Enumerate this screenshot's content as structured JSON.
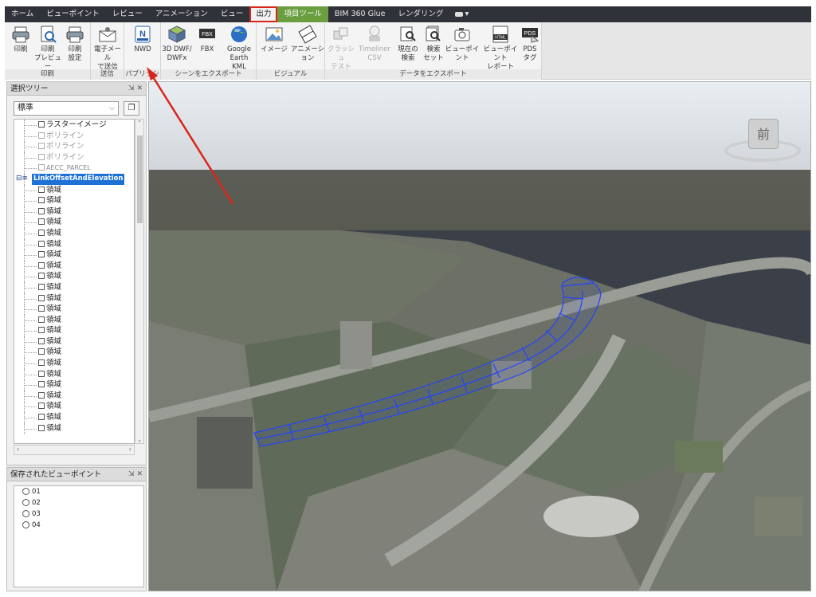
{
  "tabs": [
    {
      "label": "ホーム"
    },
    {
      "label": "ビューポイント"
    },
    {
      "label": "レビュー"
    },
    {
      "label": "アニメーション"
    },
    {
      "label": "ビュー"
    },
    {
      "label": "出力",
      "active": true
    },
    {
      "label": "項目ツール",
      "context": true
    },
    {
      "label": "BIM 360 Glue"
    },
    {
      "label": "レンダリング"
    }
  ],
  "ribbon": {
    "groups": {
      "print": "印刷",
      "send": "送信",
      "publish": "パブリッシュ",
      "export_scene": "シーンをエクスポート",
      "visual": "ビジュアル",
      "export_data": "データをエクスポート"
    },
    "buttons": {
      "print": "印刷",
      "print_preview": "印刷\nプレビュー",
      "print_setup": "印刷\n設定",
      "email": "電子メール\nで送信",
      "nwd": "NWD",
      "dwf": "3D DWF/\nDWFx",
      "fbx": "FBX",
      "kml": "Google\nEarth KML",
      "image": "イメージ",
      "animation": "アニメーション",
      "clash": "クラッシュ\nテスト",
      "timeliner": "Timeliner\nCSV",
      "current_search": "現在の\n検索",
      "search_set": "検索\nセット",
      "viewpoint": "ビューポイント",
      "vp_report": "ビューポイント\nレポート",
      "pds": "PDS\nタグ"
    }
  },
  "selection_tree": {
    "title": "選択ツリー",
    "mode": "標準",
    "items": [
      {
        "label": "ラスターイメージ",
        "dim": false
      },
      {
        "label": "ポリライン",
        "dim": true
      },
      {
        "label": "ポリライン",
        "dim": true
      },
      {
        "label": "ポリライン",
        "dim": true
      },
      {
        "label": "AECC_PARCEL",
        "dim": true,
        "small": true
      },
      {
        "label": "LinkOffsetAndElevation",
        "selected": true
      },
      {
        "label": "領域"
      },
      {
        "label": "領域"
      },
      {
        "label": "領域"
      },
      {
        "label": "領域"
      },
      {
        "label": "領域"
      },
      {
        "label": "領域"
      },
      {
        "label": "領域"
      },
      {
        "label": "領域"
      },
      {
        "label": "領域"
      },
      {
        "label": "領域"
      },
      {
        "label": "領域"
      },
      {
        "label": "領域"
      },
      {
        "label": "領域"
      },
      {
        "label": "領域"
      },
      {
        "label": "領域"
      },
      {
        "label": "領域"
      },
      {
        "label": "領域"
      },
      {
        "label": "領域"
      },
      {
        "label": "領域"
      },
      {
        "label": "領域"
      },
      {
        "label": "領域"
      },
      {
        "label": "領域"
      },
      {
        "label": "領域"
      }
    ]
  },
  "saved_viewpoints": {
    "title": "保存されたビューポイント",
    "items": [
      "01",
      "02",
      "03",
      "04"
    ]
  },
  "viewcube": {
    "face": "前"
  },
  "colors": {
    "tab_bar": "#2f3238",
    "highlight_red": "#d9261c",
    "context_tab": "#6a9e3f",
    "selection_blue": "#1e72d6",
    "corridor_blue": "#2244ff"
  }
}
